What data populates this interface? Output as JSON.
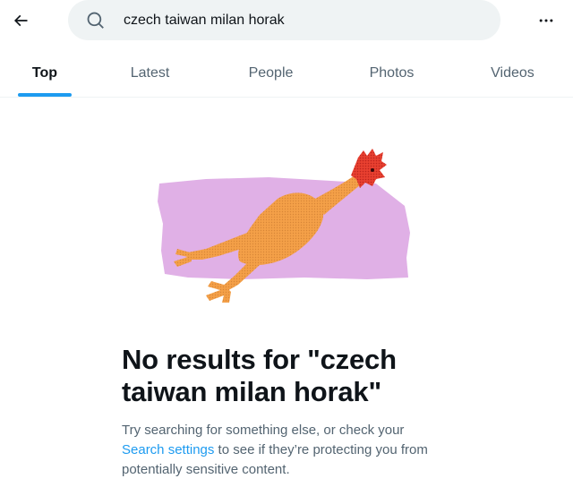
{
  "search": {
    "query": "czech taiwan milan horak",
    "back_icon": "arrow-left-icon",
    "search_icon": "search-icon",
    "more_icon": "more-horizontal-icon"
  },
  "tabs": [
    {
      "label": "Top",
      "active": true
    },
    {
      "label": "Latest",
      "active": false
    },
    {
      "label": "People",
      "active": false
    },
    {
      "label": "Photos",
      "active": false
    },
    {
      "label": "Videos",
      "active": false
    }
  ],
  "empty_state": {
    "illustration": "rubber-chicken-illustration",
    "title": "No results for \"czech taiwan milan horak\"",
    "body_before": "Try searching for something else, or check your ",
    "link_text": "Search settings",
    "body_after": " to see if they’re protecting you from potentially sensitive content."
  },
  "colors": {
    "accent": "#1d9bf0",
    "text_primary": "#0f1419",
    "text_secondary": "#536471",
    "search_bg": "#eff3f4",
    "illustration_bg": "#e0b0e6"
  }
}
